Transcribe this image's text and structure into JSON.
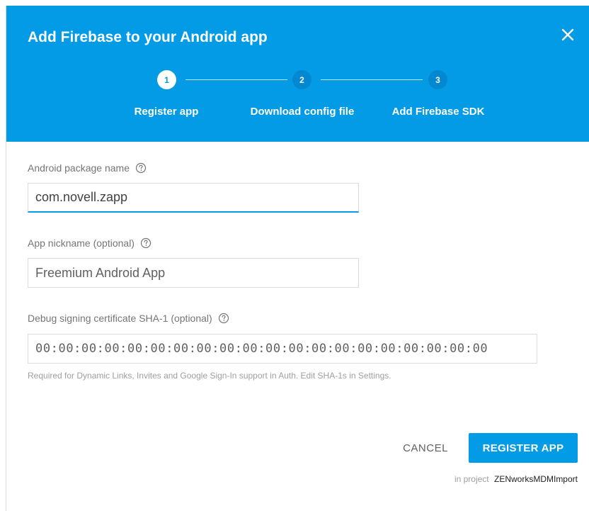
{
  "dialog": {
    "title": "Add Firebase to your Android app",
    "close_icon": "close-icon",
    "accent_color": "#039be5",
    "steps": [
      {
        "number": "1",
        "label": "Register app",
        "state": "active"
      },
      {
        "number": "2",
        "label": "Download config file",
        "state": "inactive"
      },
      {
        "number": "3",
        "label": "Add Firebase SDK",
        "state": "inactive"
      }
    ]
  },
  "form": {
    "package_name": {
      "label": "Android package name",
      "value": "com.novell.zapp",
      "help_icon": "help-circle-icon"
    },
    "app_nickname": {
      "label": "App nickname (optional)",
      "placeholder": "Freemium Android App",
      "help_icon": "help-circle-icon"
    },
    "sha1": {
      "label": "Debug signing certificate SHA-1 (optional)",
      "placeholder": "00:00:00:00:00:00:00:00:00:00:00:00:00:00:00:00:00:00:00:00",
      "help_icon": "help-circle-icon",
      "hint": "Required for Dynamic Links, Invites and Google Sign-In support in Auth. Edit SHA-1s in Settings."
    }
  },
  "actions": {
    "cancel_label": "CANCEL",
    "register_label": "REGISTER APP"
  },
  "footer": {
    "prefix": "in project",
    "project_name": "ZENworksMDMImport"
  }
}
